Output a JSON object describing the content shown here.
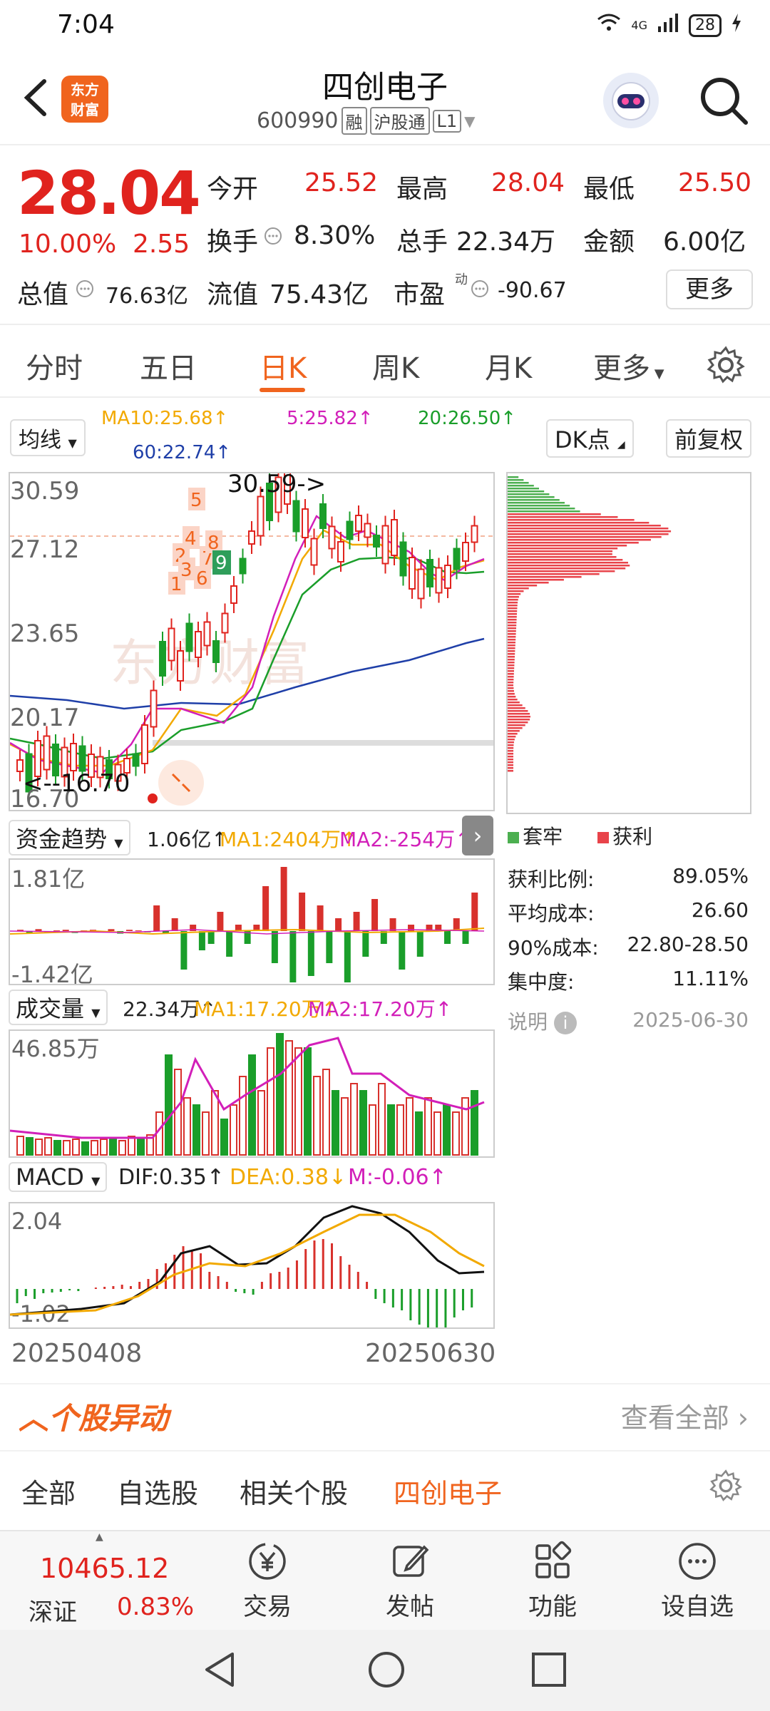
{
  "status_bar": {
    "time": "7:04",
    "network": "4G",
    "battery": "28"
  },
  "header": {
    "title": "四创电子",
    "code": "600990",
    "tag1": "融",
    "tag2": "沪股通",
    "tag3": "L1",
    "logo_line1": "东方",
    "logo_line2": "财富"
  },
  "quote": {
    "price": "28.04",
    "change_pct": "10.00%",
    "change_abs": "2.55",
    "open_label": "今开",
    "open": "25.52",
    "high_label": "最高",
    "high": "28.04",
    "low_label": "最低",
    "low": "25.50",
    "turnover_label": "换手",
    "turnover": "8.30%",
    "volume_label": "总手",
    "volume": "22.34万",
    "amount_label": "金额",
    "amount": "6.00亿",
    "mktcap_label": "总值",
    "mktcap": "76.63亿",
    "float_label": "流值",
    "float": "75.43亿",
    "pe_label": "市盈",
    "pe_sup": "动",
    "pe": "-90.67",
    "more_button": "更多"
  },
  "tabs": [
    "分时",
    "五日",
    "日K",
    "周K",
    "月K",
    "更多"
  ],
  "ma_row": {
    "indicator": "均线",
    "ma10": "MA10:25.68↑",
    "ma5": "5:25.82↑",
    "ma20": "20:26.50↑",
    "ma60": "60:22.74↑",
    "dk_button": "DK点",
    "adjust_button": "前复权"
  },
  "kline": {
    "y_labels": [
      "30.59",
      "27.12",
      "23.65",
      "20.17",
      "16.70"
    ],
    "max_marker": "30.59->",
    "min_marker": "<--16.70",
    "watermark": "东方财富",
    "signal_numbers": [
      "1",
      "2",
      "3",
      "4",
      "5",
      "6",
      "7",
      "8",
      "9"
    ]
  },
  "chip": {
    "legend_trapped": "套牢",
    "legend_profit": "获利",
    "rows": [
      {
        "label": "获利比例:",
        "value": "89.05%"
      },
      {
        "label": "平均成本:",
        "value": "26.60"
      },
      {
        "label": "90%成本:",
        "value": "22.80-28.50"
      },
      {
        "label": "集中度:",
        "value": "11.11%"
      }
    ],
    "note_label": "说明",
    "date": "2025-06-30"
  },
  "fund": {
    "name": "资金趋势",
    "value": "1.06亿↑",
    "ma1": "MA1:2404万↑",
    "ma2": "MA2:-254万↑",
    "y_top": "1.81亿",
    "y_bottom": "-1.42亿"
  },
  "vol": {
    "name": "成交量",
    "value": "22.34万↑",
    "ma1": "MA1:17.20万↑",
    "ma2": "MA2:17.20万↑",
    "y_top": "46.85万"
  },
  "macd": {
    "name": "MACD",
    "dif": "DIF:0.35↑",
    "dea": "DEA:0.38↓",
    "m": "M:-0.06↑",
    "y_top": "2.04",
    "y_bottom": "-1.02",
    "date_start": "20250408",
    "date_end": "20250630"
  },
  "movement": {
    "title": "个股异动",
    "view_all": "查看全部",
    "filters": [
      "全部",
      "自选股",
      "相关个股",
      "四创电子"
    ]
  },
  "bottom_bar": {
    "index_value": "10465.12",
    "index_name": "深证",
    "index_change": "0.83%",
    "trade": "交易",
    "post": "发帖",
    "features": "功能",
    "add_watch": "设自选"
  },
  "colors": {
    "up": "#e0231e",
    "down": "#1a9e2a",
    "accent": "#f0641e"
  }
}
